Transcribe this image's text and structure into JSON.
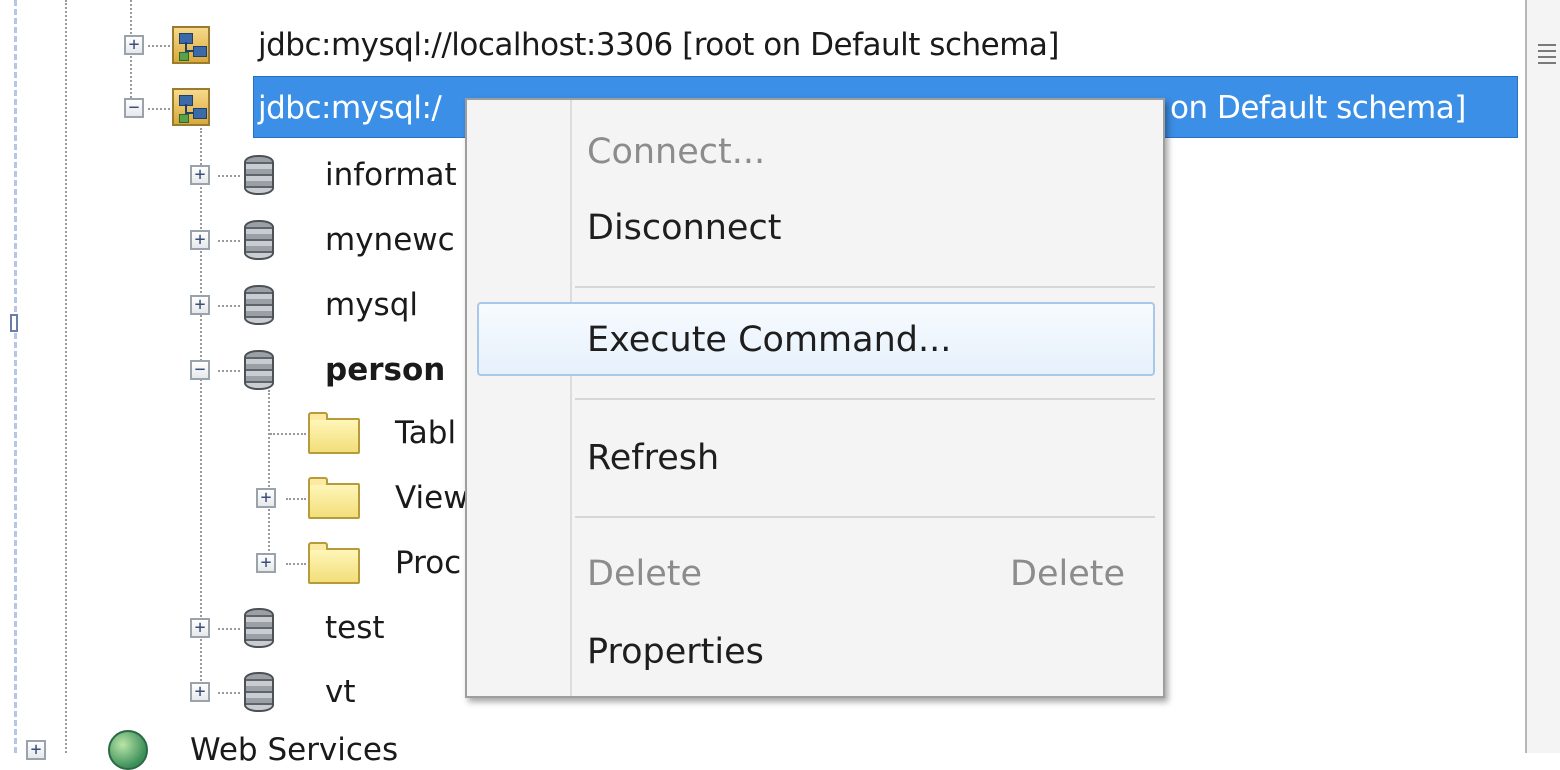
{
  "tree": {
    "connections": [
      {
        "label": "jdbc:mysql://localhost:3306 [root on Default schema]",
        "expanded": false,
        "selected": false
      },
      {
        "label_visible_left": "jdbc:mysql:/",
        "label_visible_right": "on Default schema]",
        "expanded": true,
        "selected": true
      }
    ],
    "schemas": [
      {
        "label": "informat",
        "expanded": false,
        "bold": false
      },
      {
        "label": "mynewc",
        "expanded": false,
        "bold": false
      },
      {
        "label": "mysql",
        "expanded": false,
        "bold": false
      },
      {
        "label": "person",
        "expanded": true,
        "bold": true
      },
      {
        "label": "test",
        "expanded": false,
        "bold": false
      },
      {
        "label": "vt",
        "expanded": false,
        "bold": false
      }
    ],
    "folders": [
      {
        "label": "Tabl",
        "expandable": false
      },
      {
        "label": "View",
        "expandable": true
      },
      {
        "label": "Proc",
        "expandable": true
      }
    ],
    "services": {
      "label": "Web Services"
    }
  },
  "context_menu": {
    "items": [
      {
        "label": "Connect...",
        "enabled": false
      },
      {
        "label": "Disconnect",
        "enabled": true
      },
      {
        "label": "Execute Command...",
        "enabled": true,
        "hovered": true
      },
      {
        "label": "Refresh",
        "enabled": true
      },
      {
        "label": "Delete",
        "enabled": false,
        "shortcut": "Delete"
      },
      {
        "label": "Properties",
        "enabled": true
      }
    ]
  },
  "icons": {
    "connection": "database-connection-icon",
    "schema": "database-schema-icon",
    "folder": "folder-icon",
    "services": "web-services-icon"
  },
  "colors": {
    "selection": "#3b8fe6",
    "menu_background": "#f4f4f4",
    "menu_hover_border": "#a8c8ea",
    "disabled_text": "#8c8c8c"
  }
}
